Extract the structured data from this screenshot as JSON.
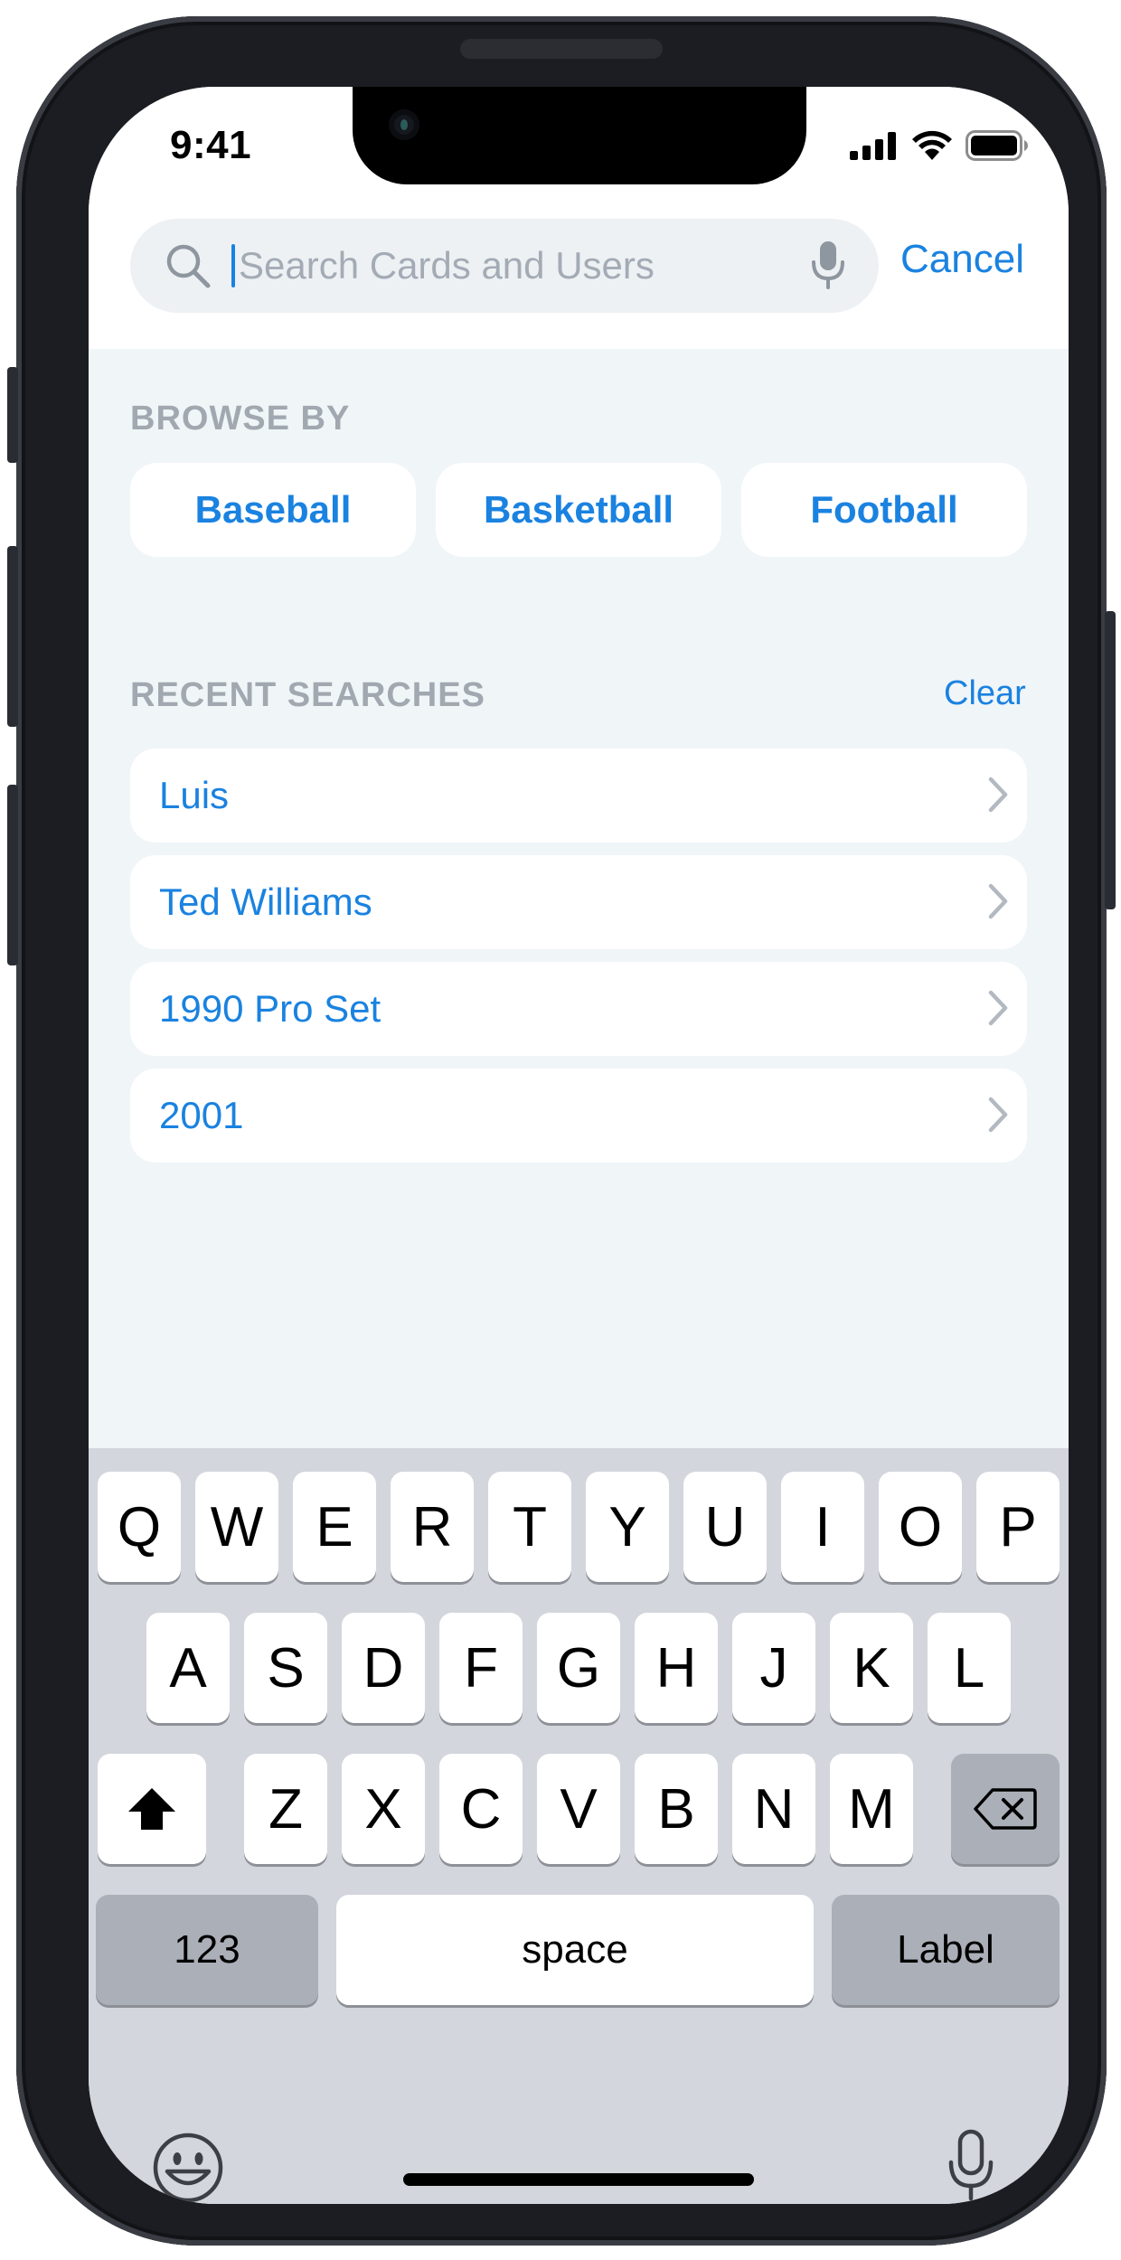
{
  "status_bar": {
    "time": "9:41"
  },
  "search": {
    "placeholder": "Search Cards and Users",
    "cancel_label": "Cancel"
  },
  "browse": {
    "heading": "BROWSE BY",
    "chips": [
      "Baseball",
      "Basketball",
      "Football"
    ]
  },
  "recent": {
    "heading": "RECENT SEARCHES",
    "clear_label": "Clear",
    "items": [
      "Luis",
      "Ted Williams",
      "1990 Pro Set",
      "2001"
    ]
  },
  "keyboard": {
    "row1": [
      "Q",
      "W",
      "E",
      "R",
      "T",
      "Y",
      "U",
      "I",
      "O",
      "P"
    ],
    "row2": [
      "A",
      "S",
      "D",
      "F",
      "G",
      "H",
      "J",
      "K",
      "L"
    ],
    "row3": [
      "Z",
      "X",
      "C",
      "V",
      "B",
      "N",
      "M"
    ],
    "numbers_label": "123",
    "space_label": "space",
    "return_label": "Label",
    "icons": {
      "shift": "shift-icon",
      "delete": "delete-icon",
      "emoji": "emoji-icon",
      "dictation": "microphone-icon"
    }
  },
  "colors": {
    "accent": "#1a82e0",
    "placeholder": "#a3abb5",
    "section_label": "#a1a8b0",
    "content_bg": "#f0f5f8",
    "keyboard_bg": "#d3d6dc"
  }
}
